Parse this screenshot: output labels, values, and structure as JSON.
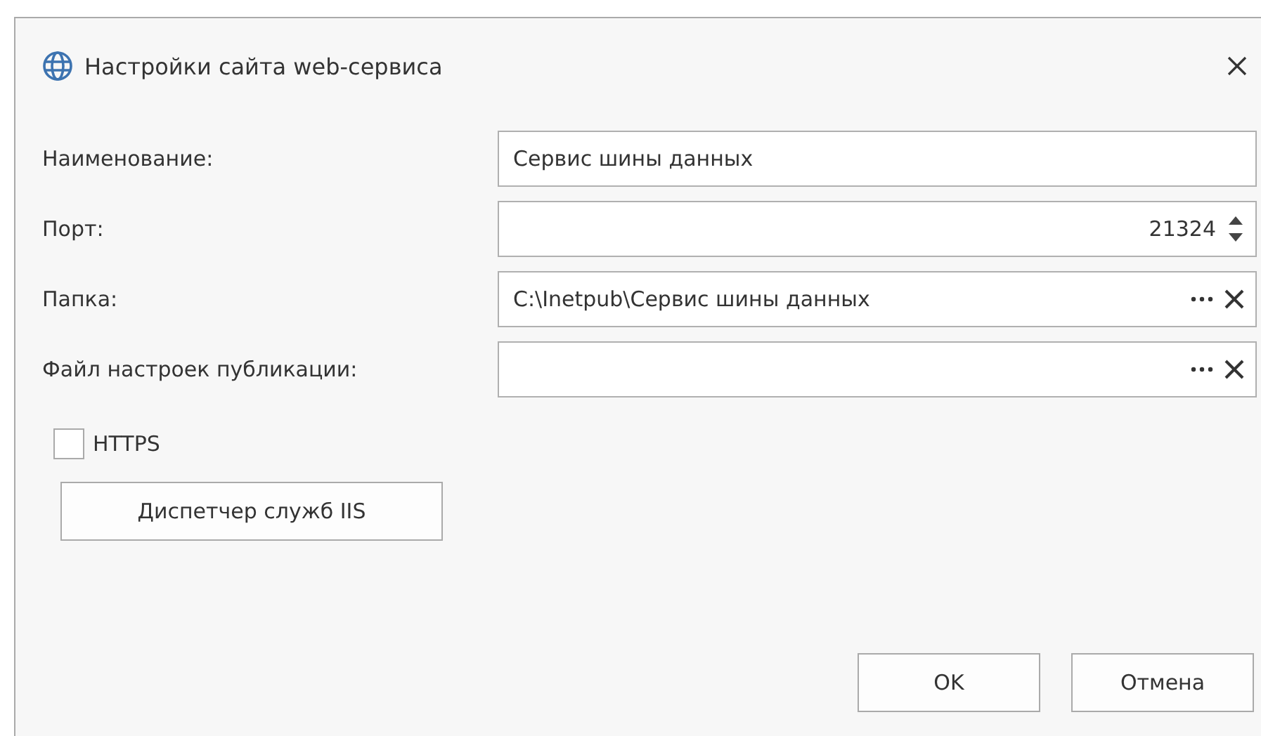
{
  "window": {
    "title": "Настройки сайта web-сервиса"
  },
  "fields": [
    {
      "label": "Наименование:",
      "kind": "text",
      "value": "Сервис шины данных"
    },
    {
      "label": "Порт:",
      "kind": "spin",
      "value": "21324"
    },
    {
      "label": "Папка:",
      "kind": "path",
      "value": "C:\\Inetpub\\Сервис шины данных"
    },
    {
      "label": "Файл настроек публикации:",
      "kind": "path"
    }
  ],
  "https": {
    "label": "HTTPS",
    "checked": false
  },
  "iis_button": "Диспетчер служб IIS",
  "buttons": [
    "OK",
    "Отмена"
  ]
}
